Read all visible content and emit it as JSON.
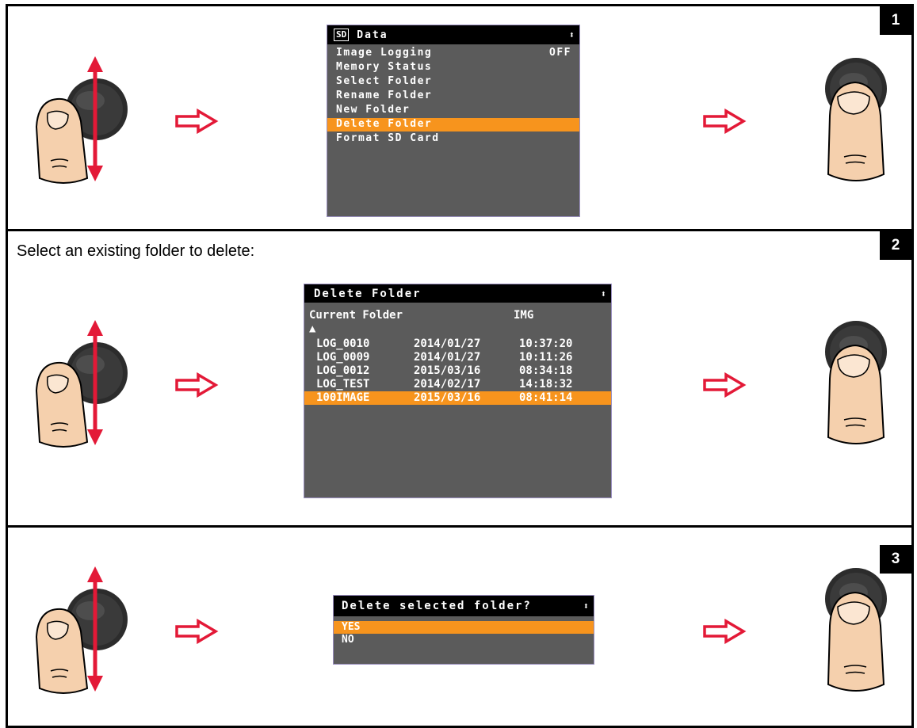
{
  "steps": {
    "step1": {
      "badge": "1",
      "screen": {
        "sd_label": "SD",
        "title": "Data",
        "updown": "⬍",
        "items": [
          {
            "label": "Image Logging",
            "value": "OFF",
            "selected": false
          },
          {
            "label": "Memory Status",
            "value": "",
            "selected": false
          },
          {
            "label": "Select Folder",
            "value": "",
            "selected": false
          },
          {
            "label": "Rename Folder",
            "value": "",
            "selected": false
          },
          {
            "label": "New Folder",
            "value": "",
            "selected": false
          },
          {
            "label": "Delete Folder",
            "value": "",
            "selected": true
          },
          {
            "label": "Format SD Card",
            "value": "",
            "selected": false
          }
        ]
      }
    },
    "step2": {
      "badge": "2",
      "instruction": "Select an existing folder to delete:",
      "screen": {
        "title": "Delete Folder",
        "updown": "⬍",
        "header_left": "Current Folder",
        "header_right": "IMG",
        "up_marker": "▲",
        "folders": [
          {
            "name": "LOG_0010",
            "date": "2014/01/27",
            "time": "10:37:20",
            "selected": false
          },
          {
            "name": "LOG_0009",
            "date": "2014/01/27",
            "time": "10:11:26",
            "selected": false
          },
          {
            "name": "LOG_0012",
            "date": "2015/03/16",
            "time": "08:34:18",
            "selected": false
          },
          {
            "name": "LOG_TEST",
            "date": "2014/02/17",
            "time": "14:18:32",
            "selected": false
          },
          {
            "name": "100IMAGE",
            "date": "2015/03/16",
            "time": "08:41:14",
            "selected": true
          }
        ]
      }
    },
    "step3": {
      "badge": "3",
      "screen": {
        "title": "Delete selected folder?",
        "updown": "⬍",
        "options": [
          {
            "label": "YES",
            "selected": true
          },
          {
            "label": "NO",
            "selected": false
          }
        ]
      }
    }
  },
  "colors": {
    "lcd_background": "#5b5b5b",
    "highlight": "#f7941d",
    "arrow": "#e31937",
    "skin": "#f5d0ad",
    "knob": "#3a3a3a"
  },
  "icons": {
    "scroll_hand": "thumb-scroll-knob-icon",
    "press_hand": "thumb-press-knob-icon",
    "next_arrow": "right-outline-arrow-icon"
  }
}
